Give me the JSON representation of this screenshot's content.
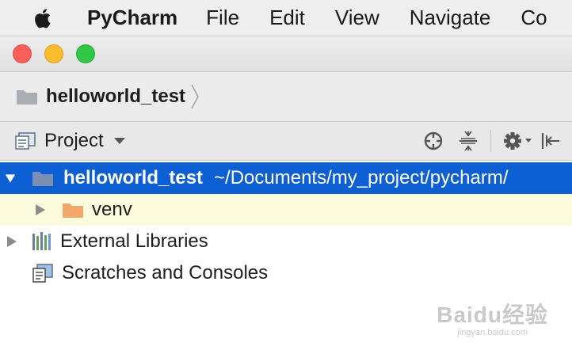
{
  "menubar": {
    "app_name": "PyCharm",
    "items": [
      "File",
      "Edit",
      "View",
      "Navigate",
      "Co"
    ]
  },
  "navbar": {
    "breadcrumb": "helloworld_test"
  },
  "tool_window": {
    "title": "Project",
    "icons": [
      "locate-icon",
      "collapse-all-icon",
      "gear-icon",
      "hide-icon"
    ]
  },
  "tree": {
    "root": {
      "name": "helloworld_test",
      "path": "~/Documents/my_project/pycharm/"
    },
    "venv": "venv",
    "external_libraries": "External Libraries",
    "scratches": "Scratches and Consoles"
  },
  "watermark": {
    "logo": "Baidu经验",
    "site": "jingyan.baidu.com"
  },
  "colors": {
    "selection": "#0f5fd4",
    "highlight_row": "#fdfbdd",
    "folder_blue": "#7a8fb2",
    "folder_orange": "#f2a86a"
  }
}
